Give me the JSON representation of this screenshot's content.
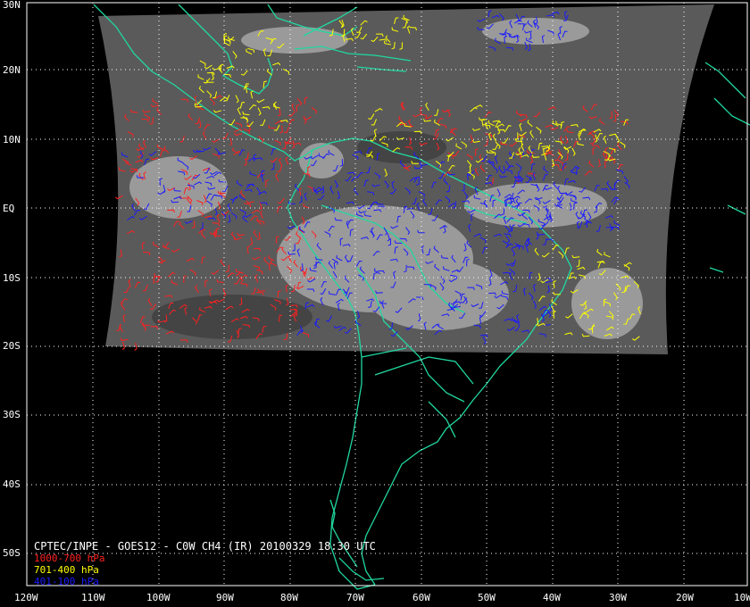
{
  "caption": "CPTEC/INPE - GOES12 - C0W CH4 (IR) 20100329 18:30 UTC",
  "legend": [
    {
      "label": "1000-700 hPa",
      "color": "#ff2020"
    },
    {
      "label": "701-400 hPa",
      "color": "#ffff00"
    },
    {
      "label": "401-100 hPa",
      "color": "#1a1aff"
    }
  ],
  "lat_labels": [
    "30N",
    "20N",
    "10N",
    "EQ",
    "10S",
    "20S",
    "30S",
    "40S",
    "50S"
  ],
  "lon_labels": [
    "120W",
    "110W",
    "100W",
    "90W",
    "80W",
    "70W",
    "60W",
    "50W",
    "40W",
    "30W",
    "20W",
    "10W"
  ],
  "colors": {
    "background": "#000000",
    "coastline": "#20d8a0",
    "grid": "#ffffff",
    "ir_imagery": "#5a5a5a"
  }
}
